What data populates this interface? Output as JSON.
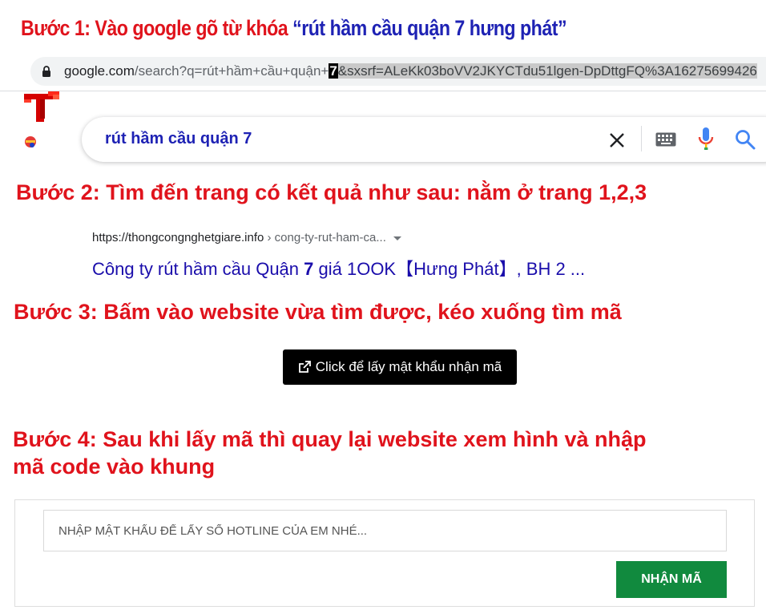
{
  "step1": {
    "prefix": "Bước 1: Vào google gõ từ khóa ",
    "keyword": "“rút hầm cầu quận 7 hưng phát”"
  },
  "url_bar": {
    "domain": "google.com",
    "path_before": "/search?q=rút+hầm+cầu+quận+",
    "highlight": "7",
    "path_after": "&sxsrf=ALeKk03boVV2JKYCTdu51lgen-DpDttgFQ%3A16275699426"
  },
  "search": {
    "query": "rút hầm cầu quận 7",
    "icons": [
      "clear-icon",
      "keyboard-icon",
      "microphone-icon",
      "search-icon"
    ]
  },
  "step2": {
    "text": "Bước 2: Tìm đến trang có kết quả như sau: nằm ở trang 1,2,3"
  },
  "result": {
    "site": "https://thongcongnghetgiare.info",
    "breadcrumb": " › cong-ty-rut-ham-ca...",
    "title_before": "Công ty rút hầm cầu Quận ",
    "title_bold": "7",
    "title_after": " giá 1OOK【Hưng Phát】, BH 2 ..."
  },
  "step3": {
    "text": "Bước 3: Bấm vào website vừa tìm được, kéo xuống tìm mã"
  },
  "get_code_button": {
    "label": "Click để lấy mật khẩu nhận mã"
  },
  "step4": {
    "line1": "Bước 4: Sau khi lấy mã thì quay lại website xem hình và nhập",
    "line2": "mã code vào khung"
  },
  "code_form": {
    "placeholder": "NHẬP MẬT KHẨU ĐỂ LẤY SỐ HOTLINE CỦA EM NHÉ...",
    "value": "",
    "submit_label": "NHẬN MÃ"
  },
  "colors": {
    "heading_red": "#e0131c",
    "keyword_blue": "#1e22b4",
    "link_blue": "#1a0dab",
    "submit_green": "#118a3e"
  }
}
